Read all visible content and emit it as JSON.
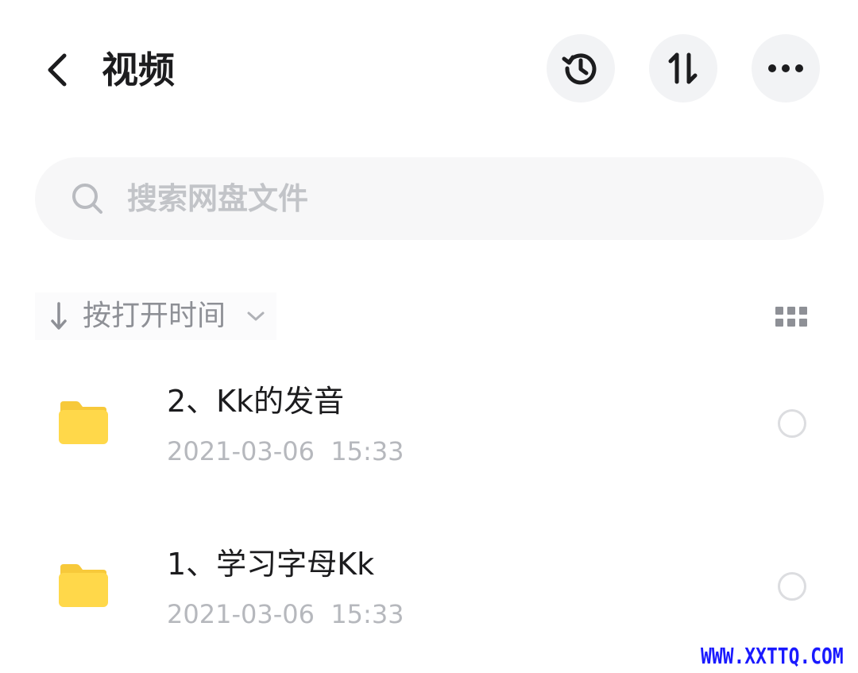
{
  "header": {
    "title": "视频",
    "icons": {
      "back": "chevron-left-icon",
      "history": "history-icon",
      "sort": "sort-arrows-icon",
      "more": "more-dots-icon"
    }
  },
  "search": {
    "placeholder": "搜索网盘文件",
    "value": "",
    "icon": "search-icon"
  },
  "sort": {
    "label": "按打开时间",
    "direction_icon": "arrow-down-icon",
    "dropdown_icon": "chevron-down-icon",
    "view_toggle_icon": "grid-view-icon"
  },
  "files": [
    {
      "name": "2、Kk的发音",
      "modified": "2021-03-06  15:33",
      "type_icon": "folder-icon",
      "selected": false
    },
    {
      "name": "1、学习字母Kk",
      "modified": "2021-03-06  15:33",
      "type_icon": "folder-icon",
      "selected": false
    }
  ],
  "watermark": {
    "text": "WWW.XXTTQ.COM"
  },
  "colors": {
    "folder": "#ffd84a",
    "folder_tab": "#f7c93a",
    "icon_dark": "#1c1c1e",
    "muted_text": "#8e9096",
    "placeholder": "#c2c4c8",
    "timestamp": "#b6b8bd",
    "button_bg": "#f2f3f5",
    "search_bg": "#f7f7f8",
    "watermark": "#1a1aff"
  }
}
